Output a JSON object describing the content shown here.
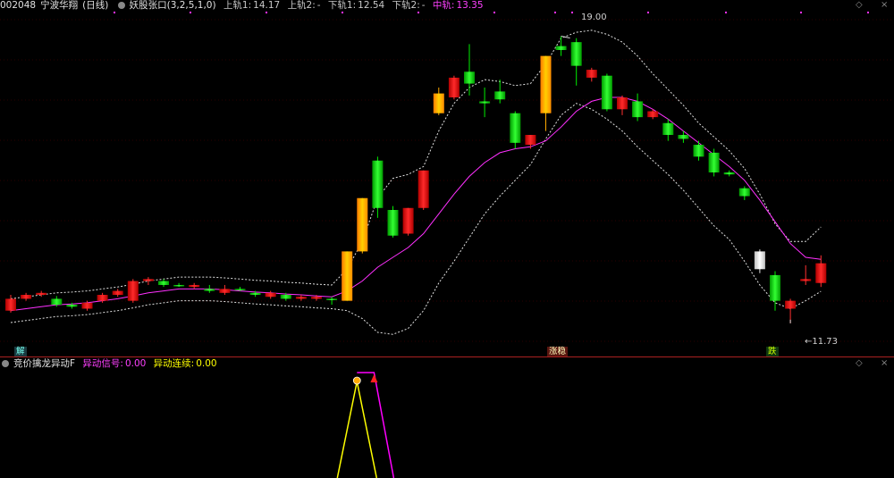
{
  "header": {
    "code": "002048",
    "name": "宁波华翔",
    "period": "(日线)",
    "indicator": "妖股张口(3,2,5,1,0)",
    "upper1_label": "上轨1:",
    "upper1_value": "14.17",
    "upper2_label": "上轨2:",
    "upper2_value": "-",
    "lower1_label": "下轨1:",
    "lower1_value": "12.54",
    "lower2_label": "下轨2:",
    "lower2_value": "-",
    "mid_label": "中轨:",
    "mid_value": "13.35"
  },
  "sub_header": {
    "indicator": "竞价擒龙异动F",
    "signal_label": "异动信号:",
    "signal_value": "0.00",
    "cont_label": "异动连续:",
    "cont_value": "0.00"
  },
  "tags": {
    "jie": "解",
    "zhang": "涨",
    "zhang2": "稳",
    "die": "跌"
  },
  "price_notes": {
    "high": "19.00",
    "low": "←11.73"
  },
  "colors": {
    "up": "#ff2020",
    "down": "#00dd00",
    "gold": "#ffaa00",
    "band": "#e0e0e0",
    "mid": "#ff30ff",
    "grid": "#5a0000",
    "signal_yellow": "#ffff00",
    "signal_magenta": "#ff00ff"
  },
  "chart_data": {
    "type": "candlestick",
    "series": [
      {
        "open": 12.05,
        "close": 12.35,
        "high": 12.45,
        "low": 12.0,
        "style": "up"
      },
      {
        "open": 12.35,
        "close": 12.45,
        "high": 12.5,
        "low": 12.3,
        "style": "up"
      },
      {
        "open": 12.45,
        "close": 12.5,
        "high": 12.55,
        "low": 12.4,
        "style": "up"
      },
      {
        "open": 12.35,
        "close": 12.2,
        "high": 12.42,
        "low": 12.15,
        "style": "down"
      },
      {
        "open": 12.2,
        "close": 12.15,
        "high": 12.25,
        "low": 12.1,
        "style": "down"
      },
      {
        "open": 12.1,
        "close": 12.25,
        "high": 12.3,
        "low": 12.05,
        "style": "up"
      },
      {
        "open": 12.3,
        "close": 12.45,
        "high": 12.5,
        "low": 12.25,
        "style": "up"
      },
      {
        "open": 12.45,
        "close": 12.55,
        "high": 12.6,
        "low": 12.4,
        "style": "up"
      },
      {
        "open": 12.3,
        "close": 12.8,
        "high": 12.85,
        "low": 12.25,
        "style": "up"
      },
      {
        "open": 12.8,
        "close": 12.85,
        "high": 12.9,
        "low": 12.7,
        "style": "up"
      },
      {
        "open": 12.8,
        "close": 12.7,
        "high": 12.85,
        "low": 12.65,
        "style": "down"
      },
      {
        "open": 12.7,
        "close": 12.7,
        "high": 12.75,
        "low": 12.65,
        "style": "down"
      },
      {
        "open": 12.65,
        "close": 12.7,
        "high": 12.75,
        "low": 12.6,
        "style": "up"
      },
      {
        "open": 12.6,
        "close": 12.55,
        "high": 12.7,
        "low": 12.5,
        "style": "down"
      },
      {
        "open": 12.5,
        "close": 12.6,
        "high": 12.7,
        "low": 12.45,
        "style": "up"
      },
      {
        "open": 12.6,
        "close": 12.6,
        "high": 12.65,
        "low": 12.55,
        "style": "down"
      },
      {
        "open": 12.5,
        "close": 12.45,
        "high": 12.55,
        "low": 12.4,
        "style": "down"
      },
      {
        "open": 12.5,
        "close": 12.4,
        "high": 12.55,
        "low": 12.35,
        "style": "up"
      },
      {
        "open": 12.45,
        "close": 12.35,
        "high": 12.5,
        "low": 12.3,
        "style": "down"
      },
      {
        "open": 12.4,
        "close": 12.35,
        "high": 12.45,
        "low": 12.3,
        "style": "up"
      },
      {
        "open": 12.4,
        "close": 12.35,
        "high": 12.45,
        "low": 12.3,
        "style": "up"
      },
      {
        "open": 12.35,
        "close": 12.35,
        "high": 12.4,
        "low": 12.2,
        "style": "down"
      },
      {
        "open": 12.3,
        "close": 13.55,
        "high": 13.55,
        "low": 12.3,
        "style": "gold"
      },
      {
        "open": 13.55,
        "close": 14.9,
        "high": 14.9,
        "low": 13.5,
        "style": "gold"
      },
      {
        "open": 15.85,
        "close": 14.65,
        "high": 15.95,
        "low": 14.4,
        "style": "down"
      },
      {
        "open": 14.6,
        "close": 13.95,
        "high": 14.7,
        "low": 13.9,
        "style": "down"
      },
      {
        "open": 14.0,
        "close": 14.65,
        "high": 14.65,
        "low": 13.95,
        "style": "up"
      },
      {
        "open": 14.65,
        "close": 15.6,
        "high": 15.6,
        "low": 14.6,
        "style": "up"
      },
      {
        "open": 17.05,
        "close": 17.55,
        "high": 17.7,
        "low": 17.0,
        "style": "gold"
      },
      {
        "open": 17.45,
        "close": 17.95,
        "high": 18.0,
        "low": 17.4,
        "style": "up"
      },
      {
        "open": 18.1,
        "close": 17.8,
        "high": 18.8,
        "low": 17.5,
        "style": "down"
      },
      {
        "open": 17.35,
        "close": 17.3,
        "high": 17.7,
        "low": 16.95,
        "style": "down"
      },
      {
        "open": 17.6,
        "close": 17.4,
        "high": 17.9,
        "low": 17.3,
        "style": "down"
      },
      {
        "open": 17.05,
        "close": 16.3,
        "high": 17.1,
        "low": 16.15,
        "style": "down"
      },
      {
        "open": 16.25,
        "close": 16.5,
        "high": 16.5,
        "low": 16.15,
        "style": "up"
      },
      {
        "open": 17.05,
        "close": 18.5,
        "high": 18.5,
        "low": 16.6,
        "style": "gold"
      },
      {
        "open": 18.65,
        "close": 18.75,
        "high": 19.0,
        "low": 18.5,
        "style": "down"
      },
      {
        "open": 18.85,
        "close": 18.25,
        "high": 18.95,
        "low": 17.75,
        "style": "down"
      },
      {
        "open": 18.15,
        "close": 17.95,
        "high": 18.2,
        "low": 17.85,
        "style": "up"
      },
      {
        "open": 18.0,
        "close": 17.15,
        "high": 18.05,
        "low": 17.1,
        "style": "down"
      },
      {
        "open": 17.45,
        "close": 17.15,
        "high": 17.5,
        "low": 17.0,
        "style": "up"
      },
      {
        "open": 17.35,
        "close": 16.95,
        "high": 17.55,
        "low": 16.85,
        "style": "down"
      },
      {
        "open": 17.1,
        "close": 16.95,
        "high": 17.15,
        "low": 16.9,
        "style": "up"
      },
      {
        "open": 16.8,
        "close": 16.5,
        "high": 16.9,
        "low": 16.35,
        "style": "down"
      },
      {
        "open": 16.5,
        "close": 16.4,
        "high": 16.6,
        "low": 16.3,
        "style": "down"
      },
      {
        "open": 16.25,
        "close": 15.95,
        "high": 16.35,
        "low": 15.85,
        "style": "down"
      },
      {
        "open": 16.05,
        "close": 15.55,
        "high": 16.15,
        "low": 15.45,
        "style": "down"
      },
      {
        "open": 15.55,
        "close": 15.5,
        "high": 15.6,
        "low": 15.45,
        "style": "down"
      },
      {
        "open": 15.15,
        "close": 14.95,
        "high": 15.2,
        "low": 14.85,
        "style": "down"
      },
      {
        "open": 13.55,
        "close": 13.1,
        "high": 13.6,
        "low": 13.0,
        "style": "white"
      },
      {
        "open": 12.95,
        "close": 12.3,
        "high": 13.05,
        "low": 12.05,
        "style": "down"
      },
      {
        "open": 12.1,
        "close": 12.3,
        "high": 12.35,
        "low": 11.73,
        "style": "up"
      },
      {
        "open": 12.8,
        "close": 12.85,
        "high": 13.2,
        "low": 12.7,
        "style": "up"
      },
      {
        "open": 12.75,
        "close": 13.25,
        "high": 13.45,
        "low": 12.65,
        "style": "up"
      }
    ],
    "mid_line": [
      12.05,
      12.1,
      12.15,
      12.2,
      12.22,
      12.25,
      12.3,
      12.35,
      12.42,
      12.5,
      12.55,
      12.6,
      12.6,
      12.6,
      12.58,
      12.55,
      12.52,
      12.5,
      12.47,
      12.45,
      12.42,
      12.4,
      12.55,
      12.8,
      13.15,
      13.4,
      13.65,
      14.0,
      14.5,
      15.0,
      15.45,
      15.8,
      16.05,
      16.15,
      16.2,
      16.35,
      16.7,
      17.1,
      17.35,
      17.45,
      17.45,
      17.35,
      17.15,
      16.9,
      16.6,
      16.3,
      16.0,
      15.7,
      15.35,
      14.85,
      14.3,
      13.75,
      13.4,
      13.35
    ],
    "upper_band": [
      12.35,
      12.4,
      12.45,
      12.5,
      12.52,
      12.55,
      12.6,
      12.65,
      12.72,
      12.8,
      12.85,
      12.9,
      12.9,
      12.9,
      12.88,
      12.85,
      12.82,
      12.8,
      12.77,
      12.75,
      12.72,
      12.7,
      13.1,
      13.8,
      14.9,
      15.4,
      15.5,
      15.7,
      16.6,
      17.3,
      17.7,
      17.9,
      17.85,
      17.75,
      17.8,
      18.3,
      18.95,
      19.1,
      19.15,
      19.05,
      18.85,
      18.5,
      18.05,
      17.65,
      17.25,
      16.8,
      16.45,
      16.1,
      15.65,
      15.0,
      14.25,
      13.8,
      13.8,
      14.17
    ],
    "lower_band": [
      11.75,
      11.8,
      11.85,
      11.9,
      11.92,
      11.95,
      12.0,
      12.05,
      12.12,
      12.2,
      12.25,
      12.3,
      12.3,
      12.3,
      12.28,
      12.25,
      12.22,
      12.2,
      12.17,
      12.15,
      12.12,
      12.1,
      12.05,
      11.85,
      11.5,
      11.45,
      11.6,
      12.05,
      12.75,
      13.3,
      13.9,
      14.5,
      14.95,
      15.35,
      15.75,
      16.4,
      17.0,
      17.3,
      17.15,
      16.9,
      16.6,
      16.2,
      15.85,
      15.5,
      15.1,
      14.65,
      14.2,
      13.85,
      13.3,
      12.7,
      12.25,
      12.1,
      12.3,
      12.54
    ],
    "yrange": [
      11.5,
      19.6
    ],
    "signal": {
      "name": "竞价擒龙异动F",
      "yellow_peak_index": 23,
      "magenta_peak_index": 24
    }
  }
}
